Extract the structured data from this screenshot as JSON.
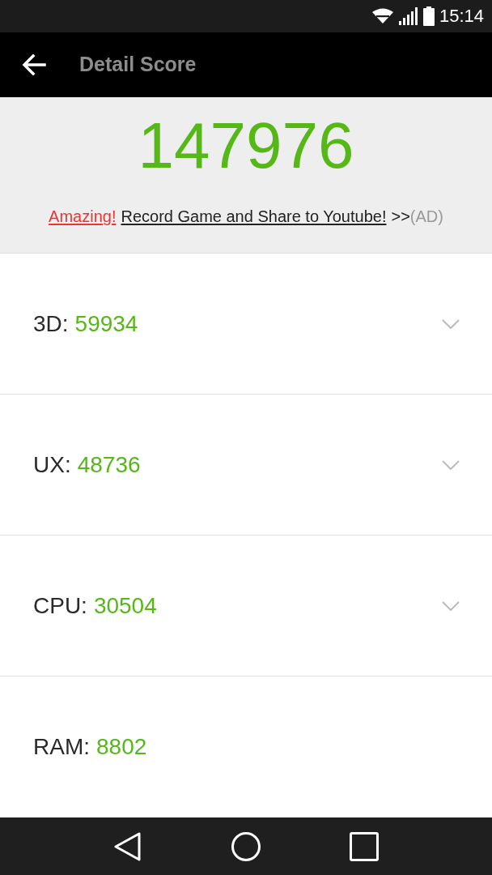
{
  "status_bar": {
    "time": "15:14"
  },
  "app_bar": {
    "title": "Detail Score"
  },
  "total": {
    "score": "147976"
  },
  "ad": {
    "highlight": "Amazing!",
    "link": "Record Game and Share to Youtube!",
    "arrow": ">>",
    "tag": "(AD)"
  },
  "scores": [
    {
      "label": "3D:",
      "value": "59934",
      "expandable": true
    },
    {
      "label": "UX:",
      "value": "48736",
      "expandable": true
    },
    {
      "label": "CPU:",
      "value": "30504",
      "expandable": true
    },
    {
      "label": "RAM:",
      "value": "8802",
      "expandable": false
    }
  ]
}
